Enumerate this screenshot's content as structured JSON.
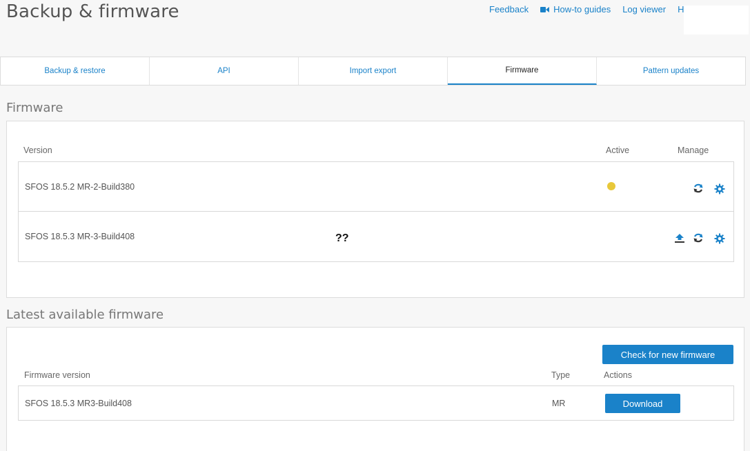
{
  "header": {
    "title": "Backup & firmware",
    "links": {
      "feedback": "Feedback",
      "howto": "How-to guides",
      "logviewer": "Log viewer",
      "help": "H"
    }
  },
  "tabs": [
    {
      "label": "Backup & restore"
    },
    {
      "label": "API"
    },
    {
      "label": "Import export"
    },
    {
      "label": "Firmware"
    },
    {
      "label": "Pattern updates"
    }
  ],
  "firmware": {
    "heading": "Firmware",
    "col_version": "Version",
    "col_active": "Active",
    "col_manage": "Manage",
    "rows": [
      {
        "version": "SFOS 18.5.2 MR-2-Build380",
        "active": true,
        "note": ""
      },
      {
        "version": "SFOS 18.5.3 MR-3-Build408",
        "active": false,
        "note": "??"
      }
    ]
  },
  "latest": {
    "heading": "Latest available firmware",
    "check_button": "Check for new firmware",
    "col_version": "Firmware version",
    "col_type": "Type",
    "col_actions": "Actions",
    "row": {
      "version": "SFOS 18.5.3 MR3-Build408",
      "type": "MR",
      "action": "Download"
    }
  },
  "colors": {
    "accent": "#1a82c9",
    "active_dot": "#e8c83a"
  },
  "icons": {
    "reboot": "reboot-icon",
    "settings": "gear-icon",
    "upload": "upload-icon",
    "video": "video-camera-icon"
  }
}
